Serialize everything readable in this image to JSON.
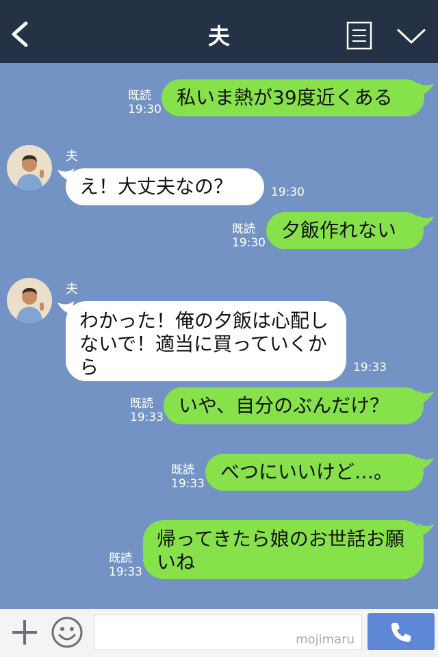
{
  "header": {
    "title": "夫",
    "back_icon": "chevron-left-icon",
    "menu_icon": "note-icon",
    "expand_icon": "chevron-down-icon"
  },
  "messages": [
    {
      "side": "out",
      "text": "私いま熱が39度近くある",
      "read": "既読",
      "time": "19:30"
    },
    {
      "side": "in",
      "sender": "夫",
      "text": "え！大丈夫なの？",
      "time": "19:30"
    },
    {
      "side": "out",
      "text": "夕飯作れない",
      "read": "既読",
      "time": "19:30"
    },
    {
      "side": "in",
      "sender": "夫",
      "text": "わかった！俺の夕飯は心配しないで！適当に買っていくから",
      "time": "19:33"
    },
    {
      "side": "out",
      "text": "いや、自分のぶんだけ？",
      "read": "既読",
      "time": "19:33"
    },
    {
      "side": "out",
      "text": "べつにいいけど…。",
      "read": "既読",
      "time": "19:33"
    },
    {
      "side": "out",
      "text": "帰ってきたら娘のお世話お願いね",
      "read": "既読",
      "time": "19:33"
    }
  ],
  "footer": {
    "input_value": "",
    "watermark": "mojimaru",
    "plus_icon": "plus-icon",
    "emoji_icon": "smile-icon",
    "call_icon": "phone-icon"
  },
  "colors": {
    "background": "#7393c4",
    "header": "#253145",
    "outgoing_bubble": "#86e14a",
    "incoming_bubble": "#ffffff",
    "call_button": "#5f87d8"
  }
}
